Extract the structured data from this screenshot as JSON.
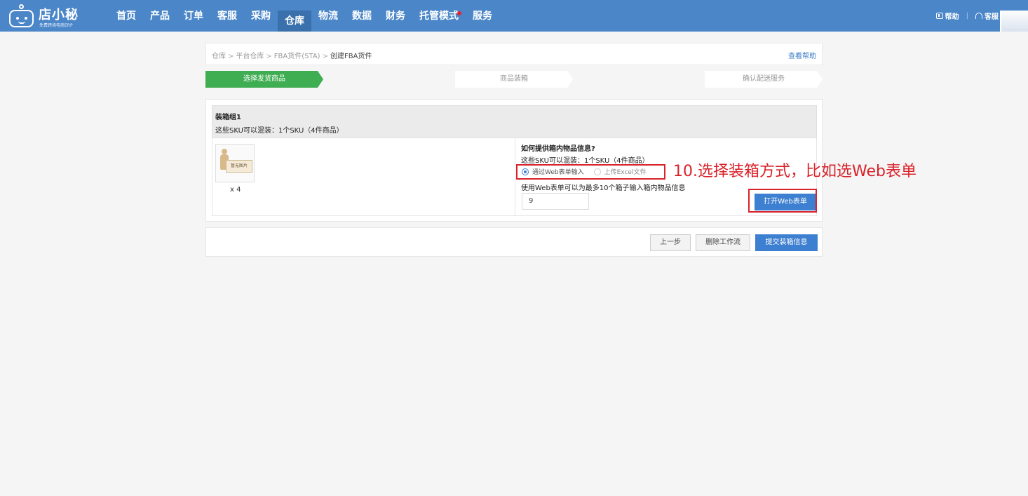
{
  "app": {
    "logo_name": "店小秘",
    "logo_sub": "免费跨境电商ERP"
  },
  "nav": {
    "items": [
      {
        "label": "首页"
      },
      {
        "label": "产品"
      },
      {
        "label": "订单"
      },
      {
        "label": "客服"
      },
      {
        "label": "采购"
      },
      {
        "label": "仓库",
        "active": true
      },
      {
        "label": "物流"
      },
      {
        "label": "数据"
      },
      {
        "label": "财务"
      },
      {
        "label": "托管模式",
        "badge_dot": true
      },
      {
        "label": "服务"
      }
    ],
    "help_label": "帮助",
    "service_label": "客服",
    "accent_color": "#4a86c8"
  },
  "breadcrumb": {
    "items": [
      "仓库",
      "平台仓库",
      "FBA货件(STA)",
      "创建FBA货件"
    ],
    "help_link": "查看帮助"
  },
  "steps": {
    "items": [
      "选择发货商品",
      "商品装箱",
      "确认配送服务"
    ],
    "active_index": 0,
    "active_color": "#3fad52"
  },
  "box_group": {
    "title": "装箱组1",
    "desc": "这些SKU可以混装：1个SKU（4件商品）",
    "product": {
      "image_placeholder": "暂无图片",
      "qty": "x 4"
    },
    "question": "如何提供箱内物品信息?",
    "question_desc": "这些SKU可以混装：1个SKU（4件商品）",
    "options": [
      {
        "label": "通过Web表单输入",
        "checked": true
      },
      {
        "label": "上传Excel文件",
        "checked": false
      }
    ],
    "web_desc": "使用Web表单可以为最多10个箱子输入箱内物品信息",
    "box_count_value": "9",
    "open_button": "打开Web表单"
  },
  "annotation": {
    "text": "10.选择装箱方式，比如选Web表单",
    "color": "#d9222a"
  },
  "footer": {
    "prev_button": "上一步",
    "delete_button": "删除工作流",
    "submit_button": "提交装箱信息"
  }
}
